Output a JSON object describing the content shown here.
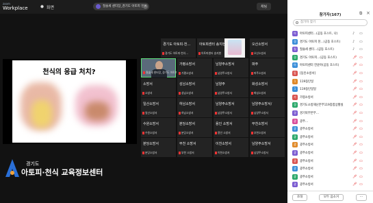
{
  "brand": {
    "small": "zoom",
    "big": "Workplace"
  },
  "topbar": {
    "view_label": "화면",
    "speaker_label": "질술세 센터장_경기도 아토피 천…",
    "chat_tab": "채팅"
  },
  "slide": {
    "title": "천식의 응급 처치?"
  },
  "logo": {
    "org_small": "경기도",
    "org_name": "아토피·천식 교육정보센터"
  },
  "gallery": {
    "tiles": [
      {
        "name": "",
        "sub": "",
        "kind": "blank"
      },
      {
        "name": "경기도 아토피·천…",
        "sub": "경기도 아토피·천식…",
        "kind": "normal"
      },
      {
        "name": "아토피센터 송지현",
        "sub": "아토피센터 송지현",
        "kind": "normal"
      },
      {
        "name": "",
        "sub": "",
        "kind": "kids"
      },
      {
        "name": "오산소방서",
        "sub": "오산소방서",
        "kind": "normal"
      },
      {
        "name": "",
        "sub": "질술세 센터장_경기도 아토피 천…",
        "kind": "video"
      },
      {
        "name": "가평소방서",
        "sub": "가평소방서",
        "kind": "normal"
      },
      {
        "name": "남양주소방서",
        "sub": "남양주소방서",
        "kind": "normal"
      },
      {
        "name": "파주",
        "sub": "파주소방서",
        "kind": "normal"
      },
      {
        "name": "소방서",
        "sub": "소방서",
        "kind": "normal"
      },
      {
        "name": "성남소방서",
        "sub": "성남소방서",
        "kind": "normal"
      },
      {
        "name": "남양주",
        "sub": "남양주소방서",
        "kind": "normal"
      },
      {
        "name": "화성소방서",
        "sub": "화성소방서",
        "kind": "normal"
      },
      {
        "name": "일산소방서",
        "sub": "일산소방서",
        "kind": "normal"
      },
      {
        "name": "하남소방서",
        "sub": "하남소방서",
        "kind": "normal"
      },
      {
        "name": "남양주소방서",
        "sub": "남양주소방서",
        "kind": "normal"
      },
      {
        "name": "남양주소방서/",
        "sub": "남양주소방서",
        "kind": "normal"
      },
      {
        "name": "수원소방서",
        "sub": "수원소방서",
        "kind": "normal"
      },
      {
        "name": "분당소방서",
        "sub": "분당소방서",
        "kind": "normal"
      },
      {
        "name": "용인 소방서",
        "sub": "용인 소방서",
        "kind": "normal"
      },
      {
        "name": "부천소방서",
        "sub": "부천소방서",
        "kind": "normal"
      },
      {
        "name": "분당소방서",
        "sub": "분당소방서",
        "kind": "normal"
      },
      {
        "name": "부천 소방서",
        "sub": "부천 소방서",
        "kind": "normal"
      },
      {
        "name": "이천소방서",
        "sub": "이천소방서",
        "kind": "normal"
      },
      {
        "name": "남양주소방서",
        "sub": "남양주소방서",
        "kind": "normal"
      }
    ]
  },
  "panel": {
    "title": "참가자(167)",
    "search_placeholder": "참가자 찾기",
    "participants": [
      {
        "name": "아토피센터…(공동 호스트, 나)",
        "color": "#7b5bd1",
        "initial": "아",
        "mic_muted": false,
        "cam_off": false
      },
      {
        "name": "경기도 아토피 천…(공동 호스트)",
        "color": "#3b8fd9",
        "initial": "경",
        "mic_muted": false,
        "cam_off": false
      },
      {
        "name": "질술세 센터…(공동 호스트)",
        "color": "#7b5bd1",
        "initial": "질",
        "mic_muted": false,
        "cam_off": false
      },
      {
        "name": "경기도 아토피…(공동 호스트)",
        "color": "#2aa86a",
        "initial": "경",
        "mic_muted": true,
        "cam_off": true
      },
      {
        "name": "아토피센터 한윤아(공동 호스트)",
        "color": "#3b8fd9",
        "initial": "아",
        "mic_muted": true,
        "cam_off": true
      },
      {
        "name": "[동탄소방서]",
        "color": "#d9534f",
        "initial": "동",
        "mic_muted": true,
        "cam_off": true
      },
      {
        "name": "119동탄일",
        "color": "#e08a2a",
        "initial": "1",
        "mic_muted": true,
        "cam_off": true
      },
      {
        "name": "119동탄일일",
        "color": "#3b8fd9",
        "initial": "1",
        "mic_muted": true,
        "cam_off": true
      },
      {
        "name": "가평소방서",
        "color": "#d9534f",
        "initial": "가",
        "mic_muted": true,
        "cam_off": true
      },
      {
        "name": "경기도소방재난본부119종합상황실",
        "color": "#2aa86a",
        "initial": "경",
        "mic_muted": true,
        "cam_off": true
      },
      {
        "name": "경기북부본부…",
        "color": "#7b5bd1",
        "initial": "경",
        "mic_muted": true,
        "cam_off": true
      },
      {
        "name": "광주…",
        "color": "#d94f9a",
        "initial": "광",
        "mic_muted": true,
        "cam_off": true
      },
      {
        "name": "광주소방서",
        "color": "#3b8fd9",
        "initial": "광",
        "mic_muted": true,
        "cam_off": true
      },
      {
        "name": "광주소방서",
        "color": "#2aa86a",
        "initial": "광",
        "mic_muted": true,
        "cam_off": true
      },
      {
        "name": "광주소방서",
        "color": "#e08a2a",
        "initial": "광",
        "mic_muted": true,
        "cam_off": true
      },
      {
        "name": "광주소방서",
        "color": "#7b5bd1",
        "initial": "광",
        "mic_muted": true,
        "cam_off": true
      },
      {
        "name": "광주소방서",
        "color": "#d9534f",
        "initial": "광",
        "mic_muted": true,
        "cam_off": true
      },
      {
        "name": "광주소방서",
        "color": "#3b8fd9",
        "initial": "광",
        "mic_muted": true,
        "cam_off": true
      },
      {
        "name": "광주소방서",
        "color": "#2aa86a",
        "initial": "광",
        "mic_muted": true,
        "cam_off": true
      },
      {
        "name": "광주소방서",
        "color": "#7b5bd1",
        "initial": "광",
        "mic_muted": true,
        "cam_off": true
      }
    ],
    "invite_label": "초대",
    "mute_all_label": "모두 음소거",
    "more_label": "···"
  }
}
